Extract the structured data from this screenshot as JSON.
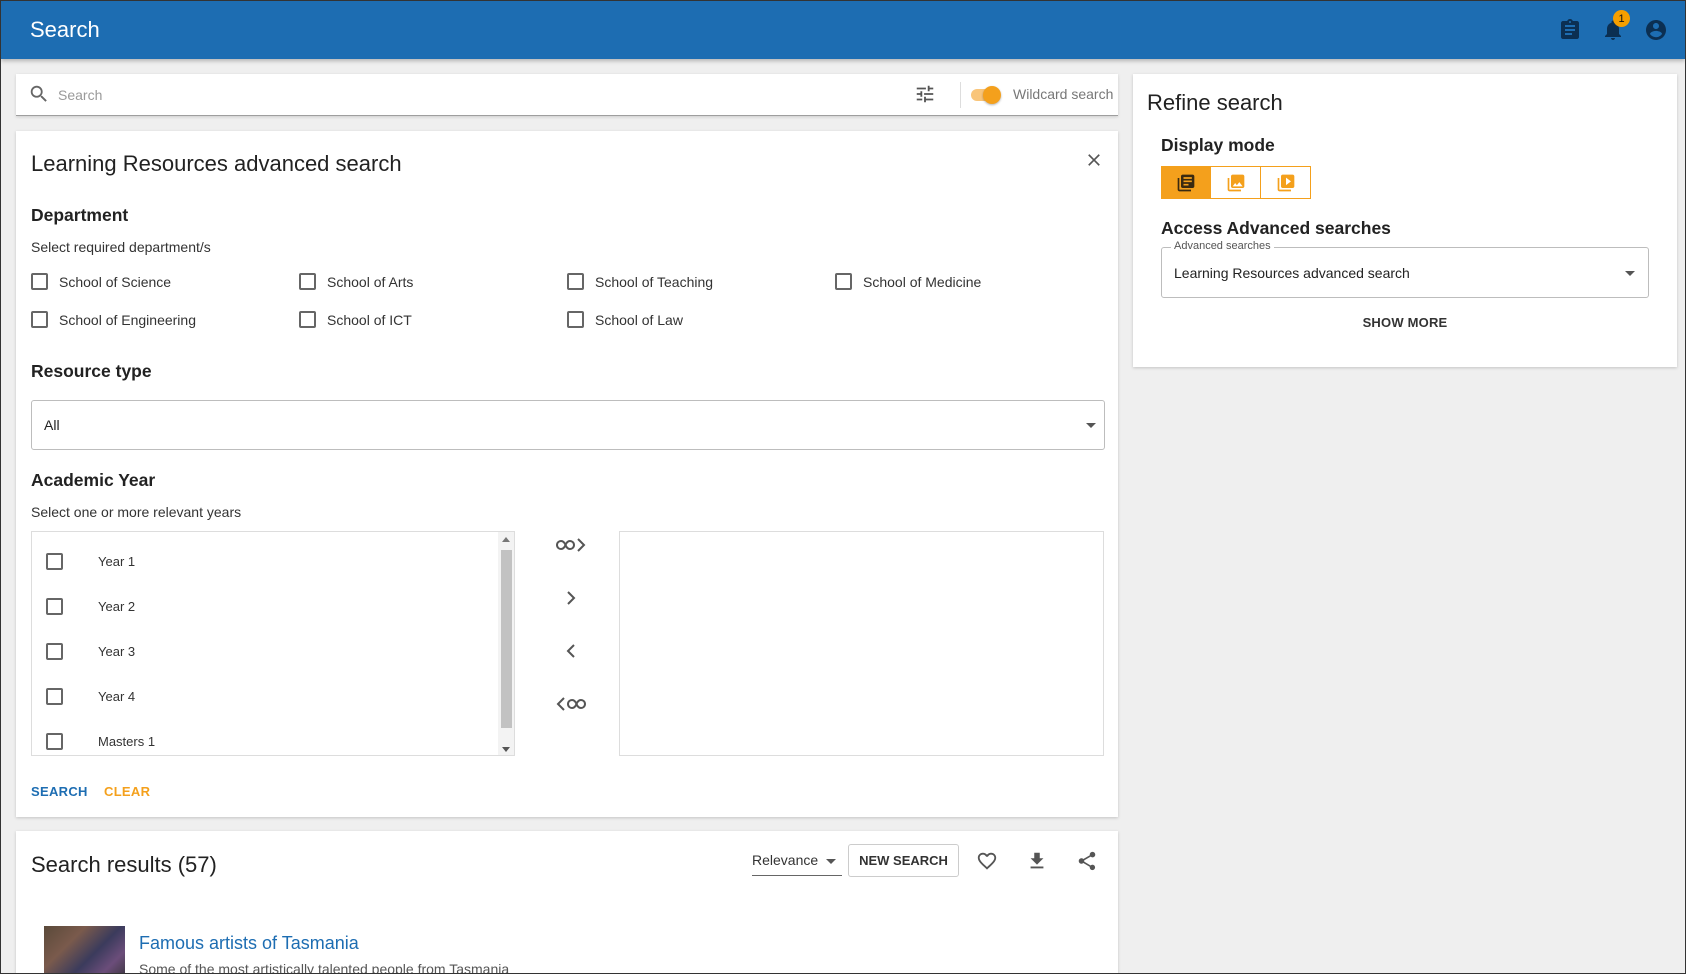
{
  "header": {
    "title": "Search",
    "notification_count": "1",
    "icons": [
      "clipboard-icon",
      "bell-icon",
      "account-icon"
    ]
  },
  "search": {
    "placeholder": "Search",
    "wildcard_label": "Wildcard search",
    "wildcard_enabled": true
  },
  "advanced": {
    "title": "Learning Resources advanced search",
    "department": {
      "heading": "Department",
      "subtitle": "Select required department/s",
      "options": [
        "School of Science",
        "School of Arts",
        "School of Teaching",
        "School of Medicine",
        "School of Engineering",
        "School of ICT",
        "School of Law"
      ]
    },
    "resource_type": {
      "heading": "Resource type",
      "value": "All"
    },
    "academic_year": {
      "heading": "Academic Year",
      "subtitle": "Select one or more relevant years",
      "options": [
        "Year 1",
        "Year 2",
        "Year 3",
        "Year 4",
        "Masters 1"
      ]
    },
    "search_label": "SEARCH",
    "clear_label": "CLEAR"
  },
  "results": {
    "title": "Search results (57)",
    "sort_value": "Relevance",
    "new_search_label": "NEW SEARCH",
    "items": [
      {
        "title": "Famous artists of Tasmania",
        "description": "Some of the most artistically talented people from Tasmania"
      }
    ]
  },
  "refine": {
    "title": "Refine search",
    "display_mode_heading": "Display mode",
    "access_heading": "Access Advanced searches",
    "advanced_searches_label": "Advanced searches",
    "advanced_searches_value": "Learning Resources advanced search",
    "show_more_label": "SHOW MORE"
  },
  "colors": {
    "brand": "#1d6db2",
    "accent": "#f4a01c",
    "link": "#1d6db2"
  }
}
